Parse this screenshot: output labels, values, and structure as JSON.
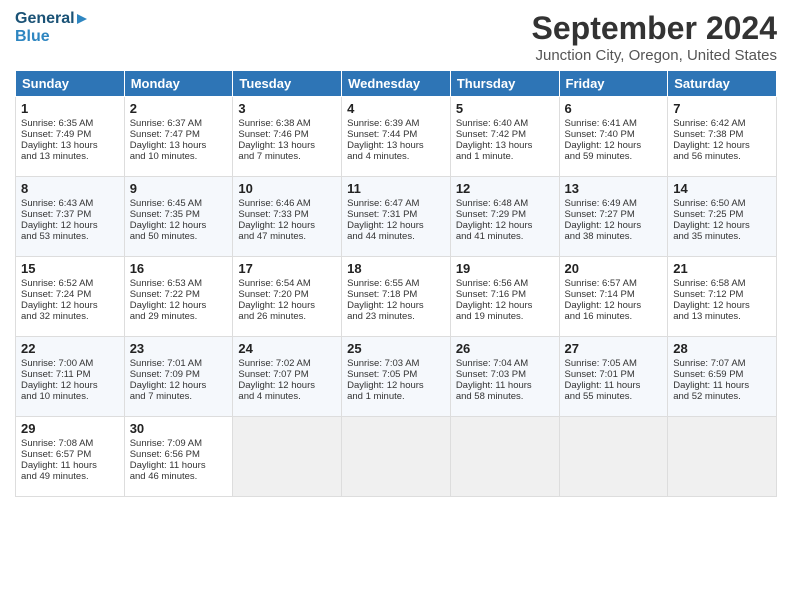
{
  "header": {
    "logo_line1": "General",
    "logo_line2": "Blue",
    "title": "September 2024",
    "subtitle": "Junction City, Oregon, United States"
  },
  "calendar": {
    "days_of_week": [
      "Sunday",
      "Monday",
      "Tuesday",
      "Wednesday",
      "Thursday",
      "Friday",
      "Saturday"
    ],
    "weeks": [
      [
        {
          "day": "1",
          "lines": [
            "Sunrise: 6:35 AM",
            "Sunset: 7:49 PM",
            "Daylight: 13 hours",
            "and 13 minutes."
          ]
        },
        {
          "day": "2",
          "lines": [
            "Sunrise: 6:37 AM",
            "Sunset: 7:47 PM",
            "Daylight: 13 hours",
            "and 10 minutes."
          ]
        },
        {
          "day": "3",
          "lines": [
            "Sunrise: 6:38 AM",
            "Sunset: 7:46 PM",
            "Daylight: 13 hours",
            "and 7 minutes."
          ]
        },
        {
          "day": "4",
          "lines": [
            "Sunrise: 6:39 AM",
            "Sunset: 7:44 PM",
            "Daylight: 13 hours",
            "and 4 minutes."
          ]
        },
        {
          "day": "5",
          "lines": [
            "Sunrise: 6:40 AM",
            "Sunset: 7:42 PM",
            "Daylight: 13 hours",
            "and 1 minute."
          ]
        },
        {
          "day": "6",
          "lines": [
            "Sunrise: 6:41 AM",
            "Sunset: 7:40 PM",
            "Daylight: 12 hours",
            "and 59 minutes."
          ]
        },
        {
          "day": "7",
          "lines": [
            "Sunrise: 6:42 AM",
            "Sunset: 7:38 PM",
            "Daylight: 12 hours",
            "and 56 minutes."
          ]
        }
      ],
      [
        {
          "day": "8",
          "lines": [
            "Sunrise: 6:43 AM",
            "Sunset: 7:37 PM",
            "Daylight: 12 hours",
            "and 53 minutes."
          ]
        },
        {
          "day": "9",
          "lines": [
            "Sunrise: 6:45 AM",
            "Sunset: 7:35 PM",
            "Daylight: 12 hours",
            "and 50 minutes."
          ]
        },
        {
          "day": "10",
          "lines": [
            "Sunrise: 6:46 AM",
            "Sunset: 7:33 PM",
            "Daylight: 12 hours",
            "and 47 minutes."
          ]
        },
        {
          "day": "11",
          "lines": [
            "Sunrise: 6:47 AM",
            "Sunset: 7:31 PM",
            "Daylight: 12 hours",
            "and 44 minutes."
          ]
        },
        {
          "day": "12",
          "lines": [
            "Sunrise: 6:48 AM",
            "Sunset: 7:29 PM",
            "Daylight: 12 hours",
            "and 41 minutes."
          ]
        },
        {
          "day": "13",
          "lines": [
            "Sunrise: 6:49 AM",
            "Sunset: 7:27 PM",
            "Daylight: 12 hours",
            "and 38 minutes."
          ]
        },
        {
          "day": "14",
          "lines": [
            "Sunrise: 6:50 AM",
            "Sunset: 7:25 PM",
            "Daylight: 12 hours",
            "and 35 minutes."
          ]
        }
      ],
      [
        {
          "day": "15",
          "lines": [
            "Sunrise: 6:52 AM",
            "Sunset: 7:24 PM",
            "Daylight: 12 hours",
            "and 32 minutes."
          ]
        },
        {
          "day": "16",
          "lines": [
            "Sunrise: 6:53 AM",
            "Sunset: 7:22 PM",
            "Daylight: 12 hours",
            "and 29 minutes."
          ]
        },
        {
          "day": "17",
          "lines": [
            "Sunrise: 6:54 AM",
            "Sunset: 7:20 PM",
            "Daylight: 12 hours",
            "and 26 minutes."
          ]
        },
        {
          "day": "18",
          "lines": [
            "Sunrise: 6:55 AM",
            "Sunset: 7:18 PM",
            "Daylight: 12 hours",
            "and 23 minutes."
          ]
        },
        {
          "day": "19",
          "lines": [
            "Sunrise: 6:56 AM",
            "Sunset: 7:16 PM",
            "Daylight: 12 hours",
            "and 19 minutes."
          ]
        },
        {
          "day": "20",
          "lines": [
            "Sunrise: 6:57 AM",
            "Sunset: 7:14 PM",
            "Daylight: 12 hours",
            "and 16 minutes."
          ]
        },
        {
          "day": "21",
          "lines": [
            "Sunrise: 6:58 AM",
            "Sunset: 7:12 PM",
            "Daylight: 12 hours",
            "and 13 minutes."
          ]
        }
      ],
      [
        {
          "day": "22",
          "lines": [
            "Sunrise: 7:00 AM",
            "Sunset: 7:11 PM",
            "Daylight: 12 hours",
            "and 10 minutes."
          ]
        },
        {
          "day": "23",
          "lines": [
            "Sunrise: 7:01 AM",
            "Sunset: 7:09 PM",
            "Daylight: 12 hours",
            "and 7 minutes."
          ]
        },
        {
          "day": "24",
          "lines": [
            "Sunrise: 7:02 AM",
            "Sunset: 7:07 PM",
            "Daylight: 12 hours",
            "and 4 minutes."
          ]
        },
        {
          "day": "25",
          "lines": [
            "Sunrise: 7:03 AM",
            "Sunset: 7:05 PM",
            "Daylight: 12 hours",
            "and 1 minute."
          ]
        },
        {
          "day": "26",
          "lines": [
            "Sunrise: 7:04 AM",
            "Sunset: 7:03 PM",
            "Daylight: 11 hours",
            "and 58 minutes."
          ]
        },
        {
          "day": "27",
          "lines": [
            "Sunrise: 7:05 AM",
            "Sunset: 7:01 PM",
            "Daylight: 11 hours",
            "and 55 minutes."
          ]
        },
        {
          "day": "28",
          "lines": [
            "Sunrise: 7:07 AM",
            "Sunset: 6:59 PM",
            "Daylight: 11 hours",
            "and 52 minutes."
          ]
        }
      ],
      [
        {
          "day": "29",
          "lines": [
            "Sunrise: 7:08 AM",
            "Sunset: 6:57 PM",
            "Daylight: 11 hours",
            "and 49 minutes."
          ]
        },
        {
          "day": "30",
          "lines": [
            "Sunrise: 7:09 AM",
            "Sunset: 6:56 PM",
            "Daylight: 11 hours",
            "and 46 minutes."
          ]
        },
        null,
        null,
        null,
        null,
        null
      ]
    ]
  }
}
